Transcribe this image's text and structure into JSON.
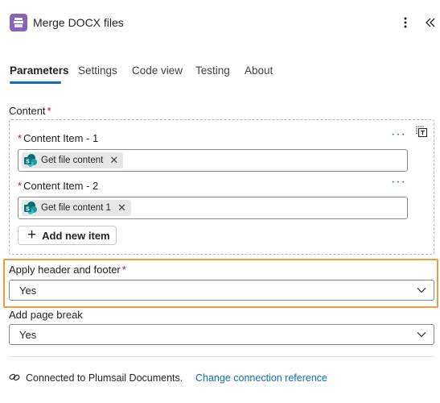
{
  "header": {
    "title": "Merge DOCX files"
  },
  "tabs": [
    {
      "label": "Parameters",
      "active": true
    },
    {
      "label": "Settings",
      "active": false
    },
    {
      "label": "Code view",
      "active": false
    },
    {
      "label": "Testing",
      "active": false
    },
    {
      "label": "About",
      "active": false
    }
  ],
  "content": {
    "label": "Content",
    "required_mark": "*",
    "items": [
      {
        "label": "Content Item - 1",
        "token": "Get file content"
      },
      {
        "label": "Content Item - 2",
        "token": "Get file content 1"
      }
    ],
    "add_button_label": "Add new item"
  },
  "apply_header_footer": {
    "label": "Apply header and footer",
    "required_mark": "*",
    "value": "Yes"
  },
  "add_page_break": {
    "label": "Add page break",
    "value": "Yes"
  },
  "connection": {
    "text": "Connected to Plumsail Documents.",
    "link": "Change connection reference"
  },
  "icons": {
    "app": "document-stack-icon",
    "token": "sharepoint-icon"
  },
  "colors": {
    "accent": "#0f6cbd",
    "app_icon": "#8764b8",
    "highlight": "#f29c38",
    "required": "#c50f1f"
  }
}
